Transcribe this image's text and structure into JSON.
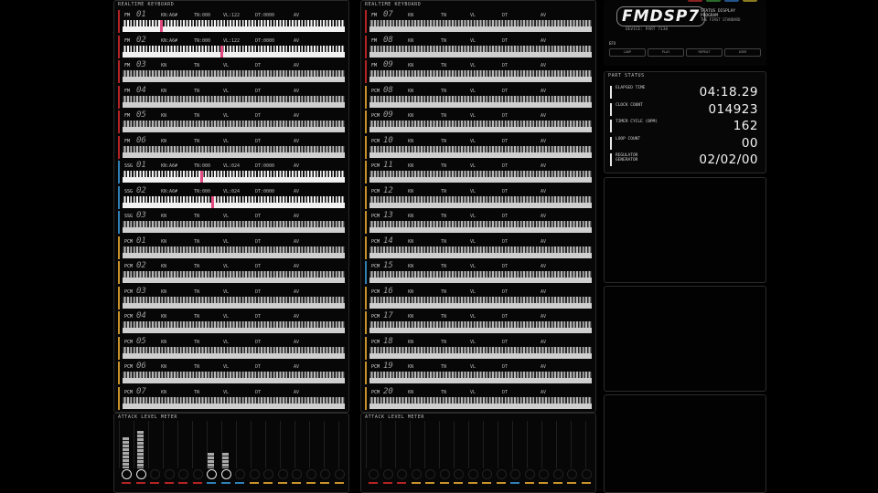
{
  "left_keyboard": {
    "title": "REALTIME KEYBOARD",
    "rows": [
      {
        "type": "FM",
        "num": "01",
        "c1": "KN:A6#",
        "c2": "TN:000",
        "c3": "VL:122",
        "c4": "DT:0000",
        "c5": "AV",
        "color": "#b32323",
        "active": true,
        "hl": [
          17
        ]
      },
      {
        "type": "FM",
        "num": "02",
        "c1": "KN:A6#",
        "c2": "TN:000",
        "c3": "VL:122",
        "c4": "DT:0000",
        "c5": "AV",
        "color": "#b32323",
        "active": true,
        "hl": [
          44
        ]
      },
      {
        "type": "FM",
        "num": "03",
        "c1": "KN",
        "c2": "TN",
        "c3": "VL",
        "c4": "DT",
        "c5": "AV",
        "color": "#b32323",
        "active": false,
        "hl": []
      },
      {
        "type": "FM",
        "num": "04",
        "c1": "KN",
        "c2": "TN",
        "c3": "VL",
        "c4": "DT",
        "c5": "AV",
        "color": "#b32323",
        "active": false,
        "hl": []
      },
      {
        "type": "FM",
        "num": "05",
        "c1": "KN",
        "c2": "TN",
        "c3": "VL",
        "c4": "DT",
        "c5": "AV",
        "color": "#b32323",
        "active": false,
        "hl": []
      },
      {
        "type": "FM",
        "num": "06",
        "c1": "KN",
        "c2": "TN",
        "c3": "VL",
        "c4": "DT",
        "c5": "AV",
        "color": "#b32323",
        "active": false,
        "hl": []
      },
      {
        "type": "SSG",
        "num": "01",
        "c1": "KN:A6#",
        "c2": "TN:000",
        "c3": "VL:024",
        "c4": "DT:0000",
        "c5": "AV",
        "color": "#2f7fb5",
        "active": true,
        "hl": [
          35
        ]
      },
      {
        "type": "SSG",
        "num": "02",
        "c1": "KN:A6#",
        "c2": "TN:000",
        "c3": "VL:024",
        "c4": "DT:0000",
        "c5": "AV",
        "color": "#2f7fb5",
        "active": true,
        "hl": [
          40
        ]
      },
      {
        "type": "SSG",
        "num": "03",
        "c1": "KN",
        "c2": "TN",
        "c3": "VL",
        "c4": "DT",
        "c5": "AV",
        "color": "#2f7fb5",
        "active": false,
        "hl": []
      },
      {
        "type": "PCM",
        "num": "01",
        "c1": "KN",
        "c2": "TN",
        "c3": "VL",
        "c4": "DT",
        "c5": "AV",
        "color": "#c7922a",
        "active": false,
        "hl": []
      },
      {
        "type": "PCM",
        "num": "02",
        "c1": "KN",
        "c2": "TN",
        "c3": "VL",
        "c4": "DT",
        "c5": "AV",
        "color": "#c7922a",
        "active": false,
        "hl": []
      },
      {
        "type": "PCM",
        "num": "03",
        "c1": "KN",
        "c2": "TN",
        "c3": "VL",
        "c4": "DT",
        "c5": "AV",
        "color": "#c7922a",
        "active": false,
        "hl": []
      },
      {
        "type": "PCM",
        "num": "04",
        "c1": "KN",
        "c2": "TN",
        "c3": "VL",
        "c4": "DT",
        "c5": "AV",
        "color": "#c7922a",
        "active": false,
        "hl": []
      },
      {
        "type": "PCM",
        "num": "05",
        "c1": "KN",
        "c2": "TN",
        "c3": "VL",
        "c4": "DT",
        "c5": "AV",
        "color": "#c7922a",
        "active": false,
        "hl": []
      },
      {
        "type": "PCM",
        "num": "06",
        "c1": "KN",
        "c2": "TN",
        "c3": "VL",
        "c4": "DT",
        "c5": "AV",
        "color": "#c7922a",
        "active": false,
        "hl": []
      },
      {
        "type": "PCM",
        "num": "07",
        "c1": "KN",
        "c2": "TN",
        "c3": "VL",
        "c4": "DT",
        "c5": "AV",
        "color": "#c7922a",
        "active": false,
        "hl": []
      }
    ]
  },
  "right_keyboard": {
    "title": "REALTIME KEYBOARD",
    "rows": [
      {
        "type": "FM",
        "num": "07",
        "c1": "KN",
        "c2": "TN",
        "c3": "VL",
        "c4": "DT",
        "c5": "AV",
        "color": "#b32323",
        "active": false,
        "hl": []
      },
      {
        "type": "FM",
        "num": "08",
        "c1": "KN",
        "c2": "TN",
        "c3": "VL",
        "c4": "DT",
        "c5": "AV",
        "color": "#b32323",
        "active": false,
        "hl": []
      },
      {
        "type": "FM",
        "num": "09",
        "c1": "KN",
        "c2": "TN",
        "c3": "VL",
        "c4": "DT",
        "c5": "AV",
        "color": "#b32323",
        "active": false,
        "hl": []
      },
      {
        "type": "PCM",
        "num": "08",
        "c1": "KN",
        "c2": "TN",
        "c3": "VL",
        "c4": "DT",
        "c5": "AV",
        "color": "#c7922a",
        "active": false,
        "hl": []
      },
      {
        "type": "PCM",
        "num": "09",
        "c1": "KN",
        "c2": "TN",
        "c3": "VL",
        "c4": "DT",
        "c5": "AV",
        "color": "#c7922a",
        "active": false,
        "hl": []
      },
      {
        "type": "PCM",
        "num": "10",
        "c1": "KN",
        "c2": "TN",
        "c3": "VL",
        "c4": "DT",
        "c5": "AV",
        "color": "#c7922a",
        "active": false,
        "hl": []
      },
      {
        "type": "PCM",
        "num": "11",
        "c1": "KN",
        "c2": "TN",
        "c3": "VL",
        "c4": "DT",
        "c5": "AV",
        "color": "#c7922a",
        "active": false,
        "hl": []
      },
      {
        "type": "PCM",
        "num": "12",
        "c1": "KN",
        "c2": "TN",
        "c3": "VL",
        "c4": "DT",
        "c5": "AV",
        "color": "#c7922a",
        "active": false,
        "hl": []
      },
      {
        "type": "PCM",
        "num": "13",
        "c1": "KN",
        "c2": "TN",
        "c3": "VL",
        "c4": "DT",
        "c5": "AV",
        "color": "#c7922a",
        "active": false,
        "hl": []
      },
      {
        "type": "PCM",
        "num": "14",
        "c1": "KN",
        "c2": "TN",
        "c3": "VL",
        "c4": "DT",
        "c5": "AV",
        "color": "#c7922a",
        "active": false,
        "hl": []
      },
      {
        "type": "PCM",
        "num": "15",
        "c1": "KN",
        "c2": "TN",
        "c3": "VL",
        "c4": "DT",
        "c5": "AV",
        "color": "#2f7fb5",
        "active": false,
        "hl": []
      },
      {
        "type": "PCM",
        "num": "16",
        "c1": "KN",
        "c2": "TN",
        "c3": "VL",
        "c4": "DT",
        "c5": "AV",
        "color": "#c7922a",
        "active": false,
        "hl": []
      },
      {
        "type": "PCM",
        "num": "17",
        "c1": "KN",
        "c2": "TN",
        "c3": "VL",
        "c4": "DT",
        "c5": "AV",
        "color": "#c7922a",
        "active": false,
        "hl": []
      },
      {
        "type": "PCM",
        "num": "18",
        "c1": "KN",
        "c2": "TN",
        "c3": "VL",
        "c4": "DT",
        "c5": "AV",
        "color": "#c7922a",
        "active": false,
        "hl": []
      },
      {
        "type": "PCM",
        "num": "19",
        "c1": "KN",
        "c2": "TN",
        "c3": "VL",
        "c4": "DT",
        "c5": "AV",
        "color": "#c7922a",
        "active": false,
        "hl": []
      },
      {
        "type": "PCM",
        "num": "20",
        "c1": "KN",
        "c2": "TN",
        "c3": "VL",
        "c4": "DT",
        "c5": "AV",
        "color": "#c7922a",
        "active": false,
        "hl": []
      }
    ]
  },
  "left_attack": {
    "title": "ATTACK LEVEL METER",
    "levels": [
      0.7,
      0.85,
      0,
      0,
      0,
      0,
      0.35,
      0.35,
      0,
      0,
      0,
      0,
      0,
      0,
      0,
      0
    ],
    "active": [
      true,
      true,
      false,
      false,
      false,
      false,
      true,
      true,
      false,
      false,
      false,
      false,
      false,
      false,
      false,
      false
    ],
    "label_colors": [
      "#b32323",
      "#b32323",
      "#b32323",
      "#b32323",
      "#b32323",
      "#b32323",
      "#2f7fb5",
      "#2f7fb5",
      "#2f7fb5",
      "#c7922a",
      "#c7922a",
      "#c7922a",
      "#c7922a",
      "#c7922a",
      "#c7922a",
      "#c7922a"
    ]
  },
  "right_attack": {
    "title": "ATTACK LEVEL METER",
    "levels": [
      0,
      0,
      0,
      0,
      0,
      0,
      0,
      0,
      0,
      0,
      0,
      0,
      0,
      0,
      0,
      0
    ],
    "active": [
      false,
      false,
      false,
      false,
      false,
      false,
      false,
      false,
      false,
      false,
      false,
      false,
      false,
      false,
      false,
      false
    ],
    "label_colors": [
      "#b32323",
      "#b32323",
      "#b32323",
      "#c7922a",
      "#c7922a",
      "#c7922a",
      "#c7922a",
      "#c7922a",
      "#c7922a",
      "#c7922a",
      "#2f7fb5",
      "#c7922a",
      "#c7922a",
      "#c7922a",
      "#c7922a",
      "#c7922a"
    ]
  },
  "header": {
    "logo": "FMDSP7",
    "subtitle_line1": "STATUS DISPLAY",
    "subtitle_line2": "PROGRAM",
    "subtitle_line3": "THE FIRST STANDARD",
    "device": "DEVICE: PART 7138",
    "fx_label": "EFX",
    "tabs": [
      "LOOP",
      "PLAY",
      "REPEAT",
      "OVER"
    ],
    "dot_colors": [
      "#8a2222",
      "#2a6a2a",
      "#24528a",
      "#8a7a22"
    ]
  },
  "status": {
    "title": "PART STATUS",
    "rows": [
      {
        "label": "ELAPSED TIME",
        "value": "04:18.29"
      },
      {
        "label": "CLOCK COUNT",
        "value": "014923"
      },
      {
        "label": "TIMER CYCLE (BPM)",
        "value": "162"
      },
      {
        "label": "LOOP COUNT",
        "value": "00"
      },
      {
        "label": "REGULATOR GENERATOR",
        "value": "02/02/00"
      }
    ]
  }
}
